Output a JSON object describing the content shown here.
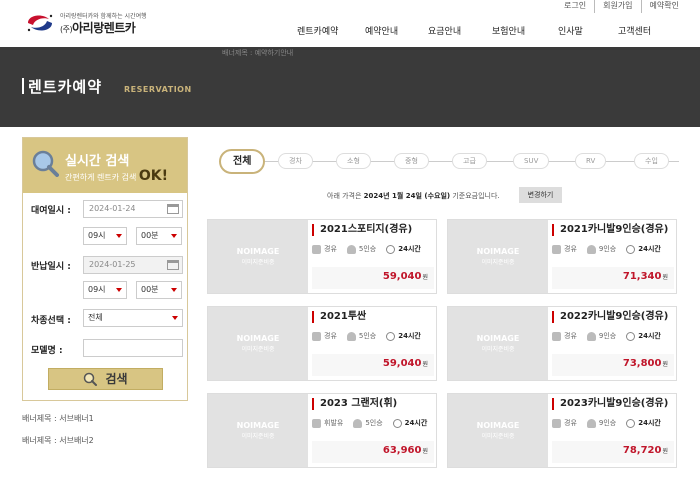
{
  "util_links": [
    "로그인",
    "회원가입",
    "예약확인"
  ],
  "logo": {
    "tagline": "아리랑렌터카와 함께하는 시간여행",
    "prefix": "(주)",
    "name": "아리랑렌트카"
  },
  "gnb": [
    "렌트카예약",
    "예약안내",
    "요금안내",
    "보험안내",
    "인사말",
    "고객센터"
  ],
  "submenu_text": "배너제목 : 예약하기안내",
  "banner": {
    "title": "렌트카예약",
    "subtitle": "RESERVATION"
  },
  "search": {
    "title": "실시간 검색",
    "subtitle": "간편하게 렌트카 검색",
    "subtitle_ok": "OK!",
    "pickup_label": "대여일시 :",
    "pickup_date": "2024-01-24",
    "pickup_hour": "09시",
    "pickup_min": "00분",
    "return_label": "반납일시 :",
    "return_date": "2024-01-25",
    "return_hour": "09시",
    "return_min": "00분",
    "type_label": "차종선택 :",
    "type_value": "전체",
    "model_label": "모델명 :",
    "model_value": "",
    "button": "검색"
  },
  "side_banners": [
    "배너제목 : 서브배너1",
    "배너제목 : 서브배너2"
  ],
  "tabs": [
    "전체",
    "경차",
    "소형",
    "중형",
    "고급",
    "SUV",
    "RV",
    "수입"
  ],
  "notice": {
    "prefix": "아래 가격은",
    "date": "2024년 1월 24일 (수요일)",
    "suffix": "기준요금입니다.",
    "button": "변경하기"
  },
  "noimage": {
    "line1": "NOIMAGE",
    "line2": "이미지준비중"
  },
  "cars": [
    {
      "name": "2021스포티지(경유)",
      "fuel": "경유",
      "seats": "5인승",
      "hours": "24시간",
      "price": "59,040",
      "unit": "원"
    },
    {
      "name": "2021카니발9인승(경유)",
      "fuel": "경유",
      "seats": "9인승",
      "hours": "24시간",
      "price": "71,340",
      "unit": "원"
    },
    {
      "name": "2021투싼",
      "fuel": "경유",
      "seats": "5인승",
      "hours": "24시간",
      "price": "59,040",
      "unit": "원"
    },
    {
      "name": "2022카니발9인승(경유)",
      "fuel": "경유",
      "seats": "9인승",
      "hours": "24시간",
      "price": "73,800",
      "unit": "원"
    },
    {
      "name": "2023 그랜저(휘)",
      "fuel": "휘발유",
      "seats": "5인승",
      "hours": "24시간",
      "price": "63,960",
      "unit": "원"
    },
    {
      "name": "2023카니발9인승(경유)",
      "fuel": "경유",
      "seats": "9인승",
      "hours": "24시간",
      "price": "78,720",
      "unit": "원"
    }
  ]
}
